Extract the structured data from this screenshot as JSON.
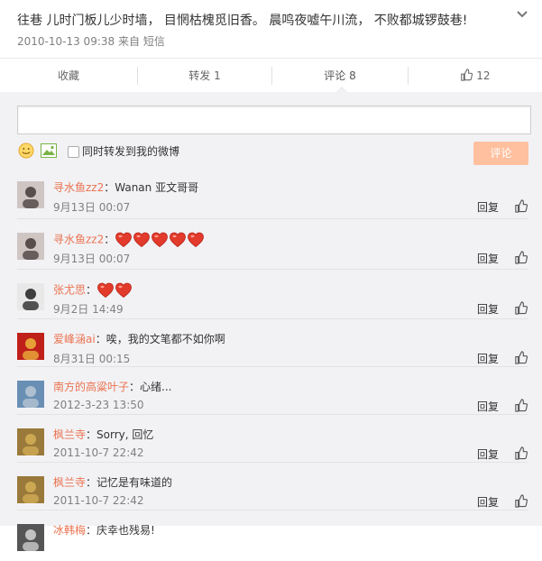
{
  "post": {
    "text": "往巷 儿时门板儿少时墙， 目惘枯槐觅旧香。 晨鸣夜嘘午川流， 不败都城锣鼓巷!",
    "time": "2010-10-13 09:38",
    "from": "来自",
    "source": "短信"
  },
  "actions": {
    "collect": "收藏",
    "repost": "转发 1",
    "comment": "评论 8",
    "like_count": "12"
  },
  "composer": {
    "input_value": "",
    "forward_label": "同时转发到我的微博",
    "submit_label": "评论"
  },
  "comments": [
    {
      "name": "寻水鱼zz2",
      "text": "Wanan 亚文哥哥",
      "hearts": 0,
      "time": "9月13日 00:07",
      "reply": "回复"
    },
    {
      "name": "寻水鱼zz2",
      "text": "",
      "hearts": 5,
      "time": "9月13日 00:07",
      "reply": "回复"
    },
    {
      "name": "张尤思",
      "text": "",
      "hearts": 2,
      "time": "9月2日 14:49",
      "reply": "回复"
    },
    {
      "name": "爱峰涵ai",
      "text": "唉，我的文笔都不如你啊",
      "hearts": 0,
      "time": "8月31日 00:15",
      "reply": "回复"
    },
    {
      "name": "南方的高粱叶子",
      "text": "心绪...",
      "hearts": 0,
      "time": "2012-3-23 13:50",
      "reply": "回复"
    },
    {
      "name": "枫兰寺",
      "text": "Sorry, 回忆",
      "hearts": 0,
      "time": "2011-10-7 22:42",
      "reply": "回复"
    },
    {
      "name": "枫兰寺",
      "text": "记忆是有味道的",
      "hearts": 0,
      "time": "2011-10-7 22:42",
      "reply": "回复"
    },
    {
      "name": "冰韩梅",
      "text": "庆幸也残易!",
      "hearts": 0,
      "time": "",
      "reply": ""
    }
  ],
  "colors": {
    "name": "#eb7350",
    "submit_bg": "#ffc09f",
    "panel_bg": "#f2f2f5"
  },
  "icons": [
    "chevron-down-icon",
    "emoji-icon",
    "image-icon",
    "thumbs-up-icon",
    "heart-icon"
  ]
}
